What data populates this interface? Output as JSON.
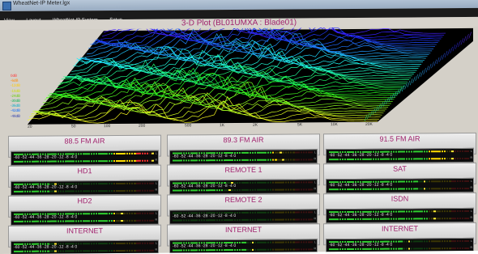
{
  "window": {
    "title": "WheatNet-IP Meter.lgx"
  },
  "menu": [
    "View",
    "Layout",
    "WheatNet-IP System",
    "Setup"
  ],
  "plot": {
    "title": "3-D Plot  (BL01UMXA : Blade01)",
    "y_labels": [
      "0dB",
      "-6dB",
      "-12dB",
      "-18dB",
      "-24dB",
      "-30dB",
      "-36dB",
      "-42dB",
      "-48dB"
    ],
    "x_labels": [
      "20",
      "50",
      "100",
      "200",
      "500",
      "1K",
      "2K",
      "5K",
      "10K",
      "20K"
    ]
  },
  "meter_scale": "-60  -52  -44  -36  -28  -20  -12 -8 -4  0",
  "meters": [
    {
      "label": "88.5  FM AIR",
      "level_l": 0.97,
      "level_r": 0.97
    },
    {
      "label": "89.3 FM AIR",
      "level_l": 0.72,
      "level_r": 0.74
    },
    {
      "label": "91.5 FM AIR",
      "level_l": 0.84,
      "level_r": 0.83
    },
    {
      "label": "HD1",
      "level_l": 0.25,
      "level_r": 0.26
    },
    {
      "label": "REMOTE 1",
      "level_l": 0.38,
      "level_r": 0.37
    },
    {
      "label": "SAT",
      "level_l": 0.64,
      "level_r": 0.63
    },
    {
      "label": "HD2",
      "level_l": 0.72,
      "level_r": 0.72
    },
    {
      "label": "REMOTE 2",
      "level_l": 0.0,
      "level_r": 0.0
    },
    {
      "label": "ISDN",
      "level_l": 0.7,
      "level_r": 0.71
    },
    {
      "label": "INTERNET",
      "level_l": 0.25,
      "level_r": 0.25
    },
    {
      "label": "INTERNET",
      "level_l": 0.52,
      "level_r": 0.52
    },
    {
      "label": "INTERNET",
      "level_l": 0.52,
      "level_r": 0.52
    }
  ]
}
